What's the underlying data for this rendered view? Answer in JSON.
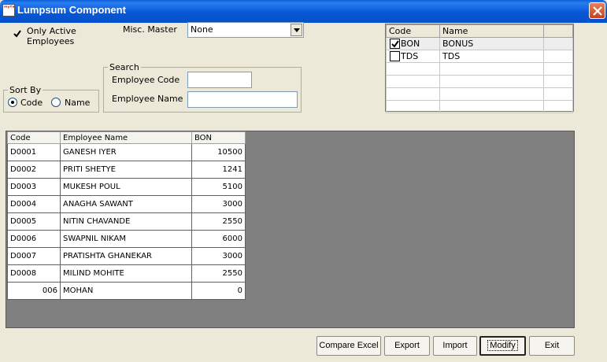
{
  "window": {
    "title": "Lumpsum Component",
    "icon_text": "ᵐʸᵗᵃ"
  },
  "filters": {
    "only_active_label_line1": "Only Active",
    "only_active_label_line2": "Employees",
    "only_active_checked": true,
    "misc_master_label": "Misc. Master",
    "misc_master_value": "None"
  },
  "search": {
    "legend": "Search",
    "employee_code_label": "Employee Code",
    "employee_code_value": "",
    "employee_name_label": "Employee Name",
    "employee_name_value": ""
  },
  "sort_by": {
    "legend": "Sort By",
    "options": [
      "Code",
      "Name"
    ],
    "selected": "Code"
  },
  "component_grid": {
    "headers": [
      "Code",
      "Name"
    ],
    "rows": [
      {
        "checked": true,
        "code": "BON",
        "name": "BONUS"
      },
      {
        "checked": false,
        "code": "TDS",
        "name": "TDS"
      }
    ]
  },
  "employee_grid": {
    "headers": [
      "Code",
      "Employee Name",
      "BON"
    ],
    "rows": [
      {
        "code": "D0001",
        "name": "GANESH IYER",
        "bon": "10500"
      },
      {
        "code": "D0002",
        "name": "PRITI SHETYE",
        "bon": "1241"
      },
      {
        "code": "D0003",
        "name": "MUKESH POUL",
        "bon": "5100"
      },
      {
        "code": "D0004",
        "name": "ANAGHA SAWANT",
        "bon": "3000"
      },
      {
        "code": "D0005",
        "name": "NITIN CHAVANDE",
        "bon": "2550"
      },
      {
        "code": "D0006",
        "name": "SWAPNIL NIKAM",
        "bon": "6000"
      },
      {
        "code": "D0007",
        "name": "PRATISHTA GHANEKAR",
        "bon": "3000"
      },
      {
        "code": "D0008",
        "name": "MILIND MOHITE",
        "bon": "2550"
      },
      {
        "code": "006",
        "name": "MOHAN",
        "bon": "0"
      }
    ]
  },
  "buttons": {
    "compare_excel": "Compare Excel",
    "export": "Export",
    "import": "Import",
    "modify": "Modify",
    "exit": "Exit"
  },
  "colors": {
    "titlebar": "#0858d6",
    "dialog_bg": "#ece9d8",
    "grid_empty_bg": "#808080"
  }
}
